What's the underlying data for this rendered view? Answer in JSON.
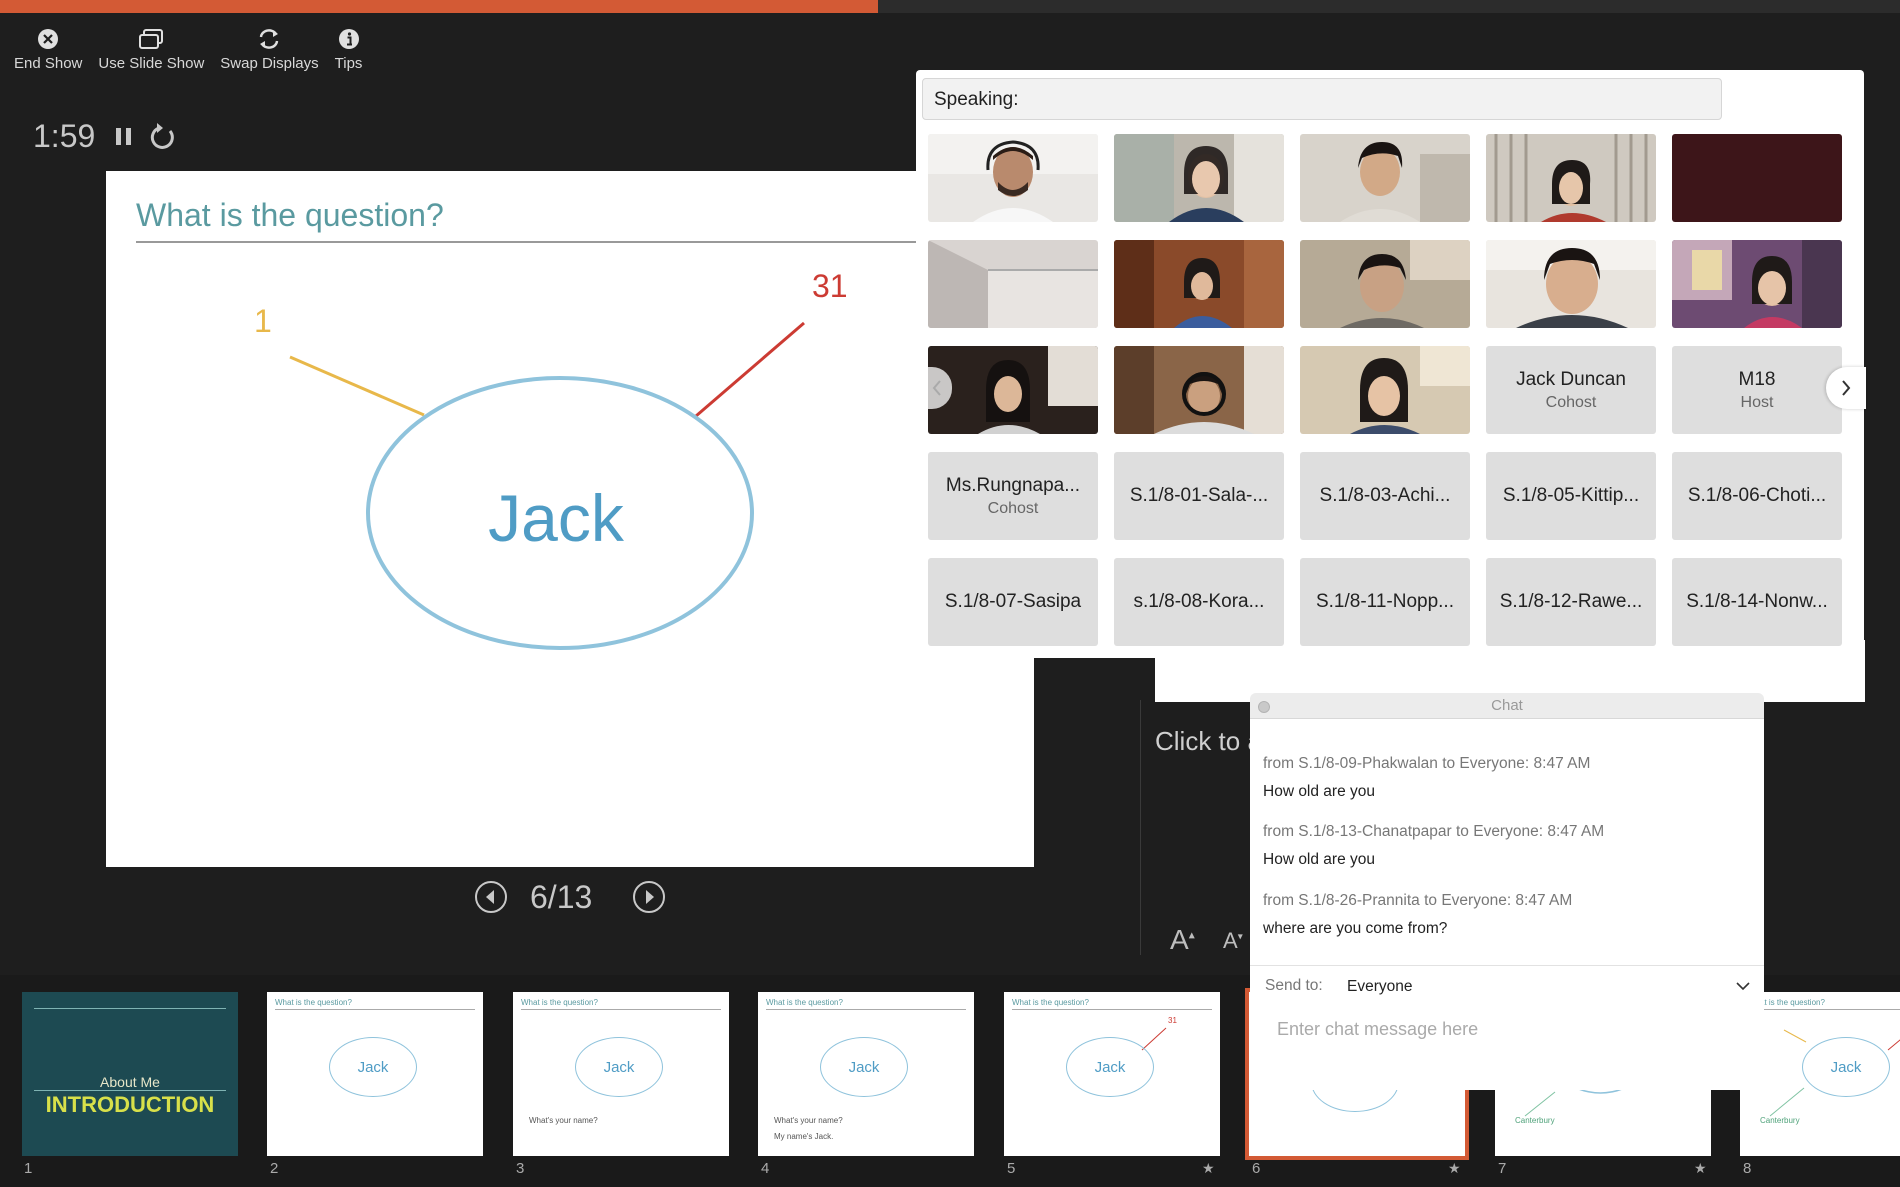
{
  "progress": {
    "fraction": 0.462
  },
  "toolbar": {
    "end_show": "End Show",
    "use_slide_show": "Use Slide Show",
    "swap_displays": "Swap Displays",
    "tips": "Tips"
  },
  "timer": {
    "elapsed": "1:59"
  },
  "slide": {
    "title": "What is the question?",
    "center_label": "Jack",
    "branch_left_label": "1",
    "branch_right_label": "31",
    "colors": {
      "title": "#5a9aa0",
      "ellipse": "#8fc3dc",
      "left_branch": "#e8b84a",
      "right_branch": "#cc3b33",
      "center": "#4f9cc5"
    }
  },
  "slide_nav": {
    "counter": "6/13"
  },
  "notes": {
    "placeholder": "Click to a",
    "font_increase": "A",
    "font_decrease": "A"
  },
  "gallery": {
    "speaking_label": "Speaking:",
    "name_tiles": [
      {
        "name": "Jack Duncan",
        "role": "Cohost"
      },
      {
        "name": "M18",
        "role": "Host"
      },
      {
        "name": "Ms.Rungnapa...",
        "role": "Cohost"
      },
      {
        "name": "S.1/8-01-Sala-...",
        "role": ""
      },
      {
        "name": "S.1/8-03-Achi...",
        "role": ""
      },
      {
        "name": "S.1/8-05-Kittip...",
        "role": ""
      },
      {
        "name": "S.1/8-06-Choti...",
        "role": ""
      },
      {
        "name": "S.1/8-07-Sasipa",
        "role": ""
      },
      {
        "name": "s.1/8-08-Kora...",
        "role": ""
      },
      {
        "name": "S.1/8-11-Nopp...",
        "role": ""
      },
      {
        "name": "S.1/8-12-Rawe...",
        "role": ""
      },
      {
        "name": "S.1/8-14-Nonw...",
        "role": ""
      }
    ]
  },
  "chat": {
    "title": "Chat",
    "messages": [
      {
        "meta": "from S.1/8-09-Phakwalan to Everyone:   8:47  AM",
        "text": "How old are you"
      },
      {
        "meta": "from S.1/8-13-Chanatpapar to Everyone:   8:47  AM",
        "text": "How old are you"
      },
      {
        "meta": "from S.1/8-26-Prannita to Everyone:   8:47  AM",
        "text": "where are you come from?"
      }
    ],
    "send_to_label": "Send to:",
    "send_to_value": "Everyone",
    "input_placeholder": "Enter chat message here"
  },
  "thumbnails": [
    {
      "num": "1",
      "title": "",
      "sub": "About Me",
      "main": "INTRODUCTION",
      "center": "",
      "star": false
    },
    {
      "num": "2",
      "title": "What is the question?",
      "center": "Jack",
      "star": false
    },
    {
      "num": "3",
      "title": "What is the question?",
      "center": "Jack",
      "line1": "What's your name?",
      "star": false
    },
    {
      "num": "4",
      "title": "What is the question?",
      "center": "Jack",
      "line1": "What's your name?",
      "line2": "My name's Jack.",
      "star": false
    },
    {
      "num": "5",
      "title": "What is the question?",
      "center": "Jack",
      "badge": "31",
      "star": true
    },
    {
      "num": "6",
      "star": true
    },
    {
      "num": "7",
      "branch": "Canterbury",
      "star": true
    },
    {
      "num": "8",
      "title": "What is the question?",
      "center": "Jack",
      "branch": "Canterbury",
      "star": false
    }
  ],
  "icons": {
    "end_show": "close-circle-icon",
    "use_slide_show": "windows-icon",
    "swap_displays": "swap-icon",
    "tips": "info-icon"
  }
}
